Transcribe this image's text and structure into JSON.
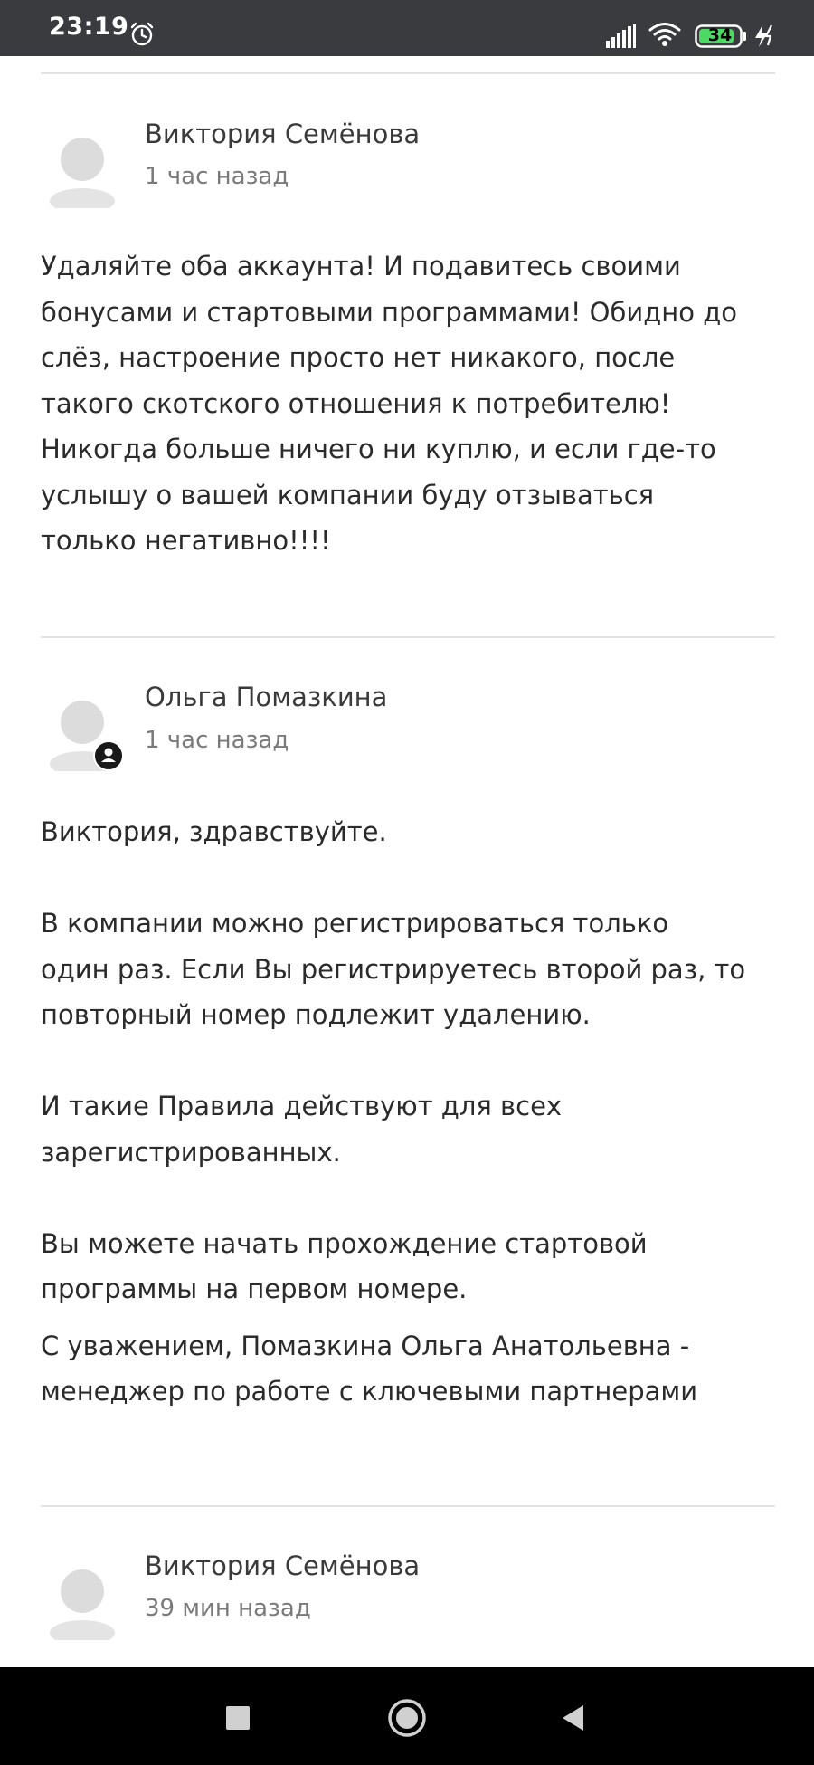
{
  "status_bar": {
    "time": "23:19",
    "battery": "34",
    "icons": [
      "alarm-icon",
      "signal-icon",
      "wifi-icon",
      "battery-icon",
      "charging-icon"
    ]
  },
  "comments": [
    {
      "author": "Виктория Семёнова",
      "time": "1 час назад",
      "lines": [
        "Удаляйте оба аккаунта! И подавитесь своими",
        "бонусами и стартовыми программами! Обидно до",
        "слёз, настроение просто нет никакого, после",
        "такого скотского отношения к потребителю!",
        "Никогда больше ничего ни куплю, и если где-то",
        "услышу о вашей компании буду отзываться",
        "только негативно!!!!"
      ]
    },
    {
      "author": "Ольга Помазкина",
      "time": "1 час назад",
      "has_badge": true,
      "lines": [
        "Виктория, здравствуйте.",
        "В компании можно регистрироваться только",
        "один раз. Если Вы регистрируетесь второй раз, то",
        "повторный номер подлежит удалению.",
        "И такие Правила действуют для всех",
        "зарегистрированных.",
        "Вы можете начать прохождение стартовой",
        "программы на первом номере.",
        "С уважением, Помазкина Ольга Анатольевна -",
        "менеджер по работе с ключевыми партнерами"
      ]
    },
    {
      "author": "Виктория Семёнова",
      "time": "39 мин назад"
    }
  ],
  "nav_bar": {
    "buttons": [
      "recents-button",
      "home-button",
      "back-button"
    ]
  },
  "colors": {
    "status_bar_bg": "#3a3b3f",
    "nav_bar_bg": "#000000",
    "divider": "#e2e2e2",
    "author_text": "#3a3a3a",
    "time_text": "#7a7a7a",
    "body_text": "#2b2b2b",
    "battery_fill": "#4cd964"
  }
}
